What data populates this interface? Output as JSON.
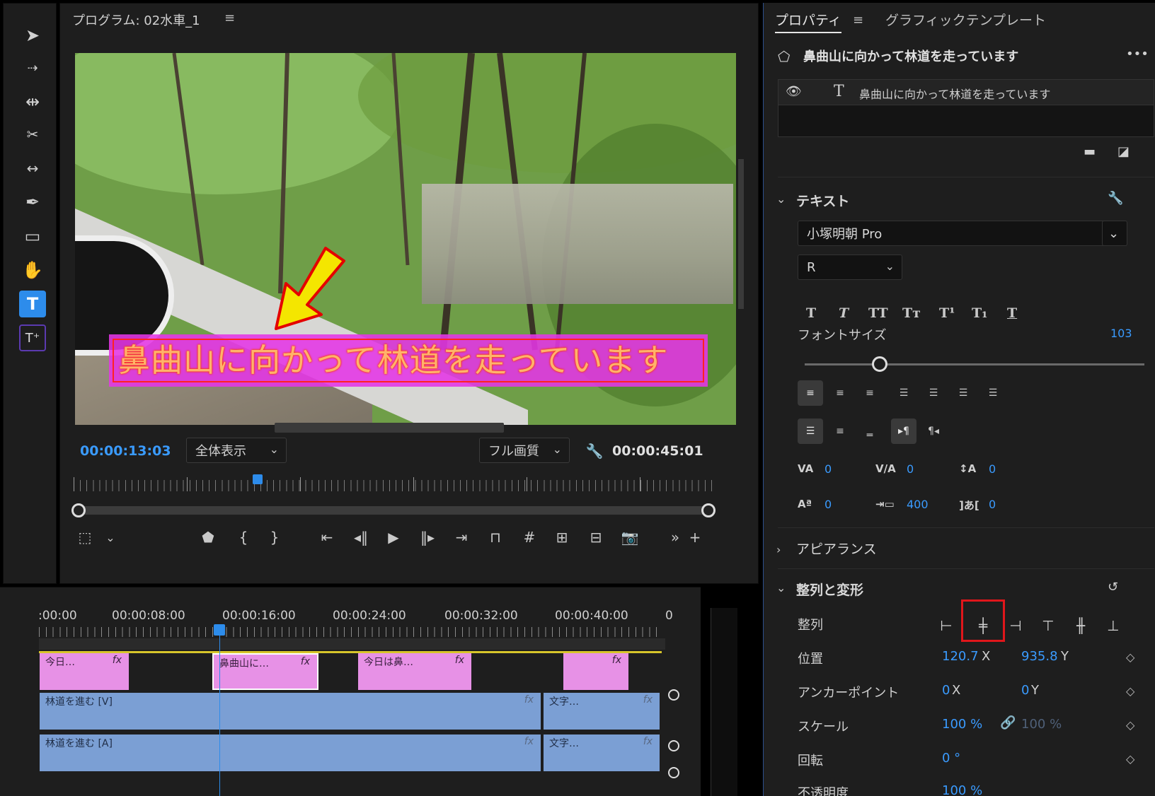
{
  "monitor": {
    "title": "プログラム: 02水車_1",
    "caption": "鼻曲山に向かって林道を走っています",
    "timecode_current": "00:00:13:03",
    "timecode_total": "00:00:45:01",
    "zoom_select": "全体表示",
    "quality_select": "フル画質"
  },
  "timeline": {
    "ruler_labels": [
      ":00:00",
      "00:00:08:00",
      "00:00:16:00",
      "00:00:24:00",
      "00:00:32:00",
      "00:00:40:00",
      "0"
    ],
    "clips_v2": [
      "今日…",
      "鼻曲山に…",
      "今日は鼻…",
      ""
    ],
    "clip_v1_a": "林道を進む [V]",
    "clip_v1_b": "文字…",
    "clip_a1_a": "林道を進む [A]",
    "clip_a1_b": "文字…",
    "fx": "fx"
  },
  "properties": {
    "tab_active": "プロパティ",
    "tab_other": "グラフィックテンプレート",
    "layer_title": "鼻曲山に向かって林道を走っています",
    "layer_name": "鼻曲山に向かって林道を走っています",
    "more": "•••",
    "text_section": "テキスト",
    "font_family": "小塚明朝 Pro",
    "font_style": "R",
    "font_size_label": "フォントサイズ",
    "font_size_value": "103",
    "font_size_fraction": 0.22,
    "kerning_value": "0",
    "tracking_value": "0",
    "leading_value": "0",
    "baseline_value": "0",
    "tab_width_value": "400",
    "tsume_value": "0",
    "appearance_section": "アピアランス",
    "align_section": "整列と変形",
    "align_label": "整列",
    "position_label": "位置",
    "position_x": "120.7",
    "position_y": "935.8",
    "anchor_label": "アンカーポイント",
    "anchor_x": "0",
    "anchor_y": "0",
    "scale_label": "スケール",
    "scale_value": "100 %",
    "scale_value_2": "100 %",
    "rotation_label": "回転",
    "rotation_value": "0 °",
    "opacity_label": "不透明度",
    "opacity_value": "100 %",
    "x_label": "X",
    "y_label": "Y"
  },
  "colors": {
    "accent": "#2d8ceb",
    "value_blue": "#3a9bff",
    "caption_bg": "#e536e6",
    "highlight": "#e0161b"
  }
}
